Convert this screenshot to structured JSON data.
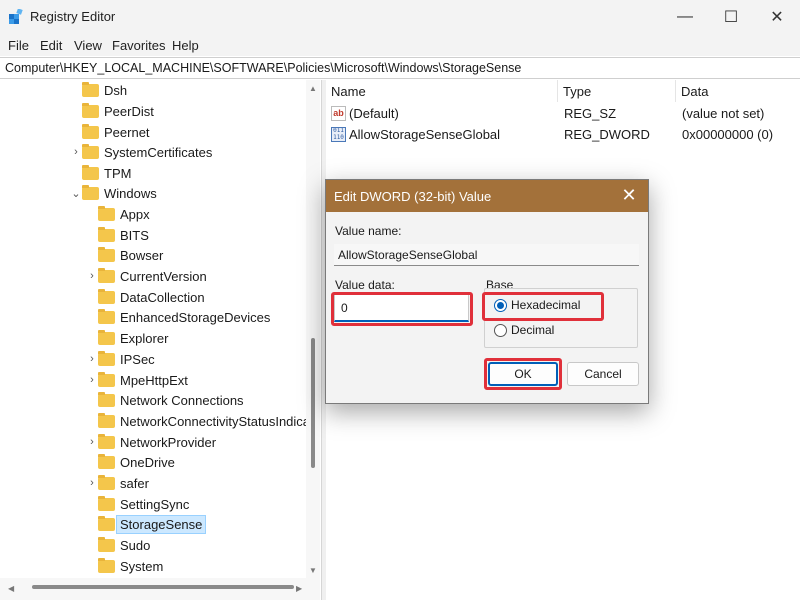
{
  "window": {
    "title": "Registry Editor",
    "minimize": "—",
    "maximize": "☐",
    "close": "✕"
  },
  "menu": [
    "File",
    "Edit",
    "View",
    "Favorites",
    "Help"
  ],
  "address": "Computer\\HKEY_LOCAL_MACHINE\\SOFTWARE\\Policies\\Microsoft\\Windows\\StorageSense",
  "tree": [
    {
      "label": "Dsh",
      "chevron": ""
    },
    {
      "label": "PeerDist",
      "chevron": ""
    },
    {
      "label": "Peernet",
      "chevron": ""
    },
    {
      "label": "SystemCertificates",
      "chevron": "›"
    },
    {
      "label": "TPM",
      "chevron": ""
    },
    {
      "label": "Windows",
      "chevron": "⌄"
    },
    {
      "label": "Appx",
      "chevron": ""
    },
    {
      "label": "BITS",
      "chevron": ""
    },
    {
      "label": "Bowser",
      "chevron": ""
    },
    {
      "label": "CurrentVersion",
      "chevron": "›"
    },
    {
      "label": "DataCollection",
      "chevron": ""
    },
    {
      "label": "EnhancedStorageDevices",
      "chevron": ""
    },
    {
      "label": "Explorer",
      "chevron": ""
    },
    {
      "label": "IPSec",
      "chevron": "›"
    },
    {
      "label": "MpeHttpExt",
      "chevron": "›"
    },
    {
      "label": "Network Connections",
      "chevron": ""
    },
    {
      "label": "NetworkConnectivityStatusIndicator",
      "chevron": ""
    },
    {
      "label": "NetworkProvider",
      "chevron": "›"
    },
    {
      "label": "OneDrive",
      "chevron": ""
    },
    {
      "label": "safer",
      "chevron": "›"
    },
    {
      "label": "SettingSync",
      "chevron": ""
    },
    {
      "label": "StorageSense",
      "chevron": ""
    },
    {
      "label": "Sudo",
      "chevron": ""
    },
    {
      "label": "System",
      "chevron": ""
    }
  ],
  "list": {
    "headers": {
      "name": "Name",
      "type": "Type",
      "data": "Data"
    },
    "rows": [
      {
        "name": "(Default)",
        "type": "REG_SZ",
        "data": "(value not set)",
        "icon": "ab",
        "icon_text": "ab"
      },
      {
        "name": "AllowStorageSenseGlobal",
        "type": "REG_DWORD",
        "data": "0x00000000 (0)",
        "icon": "binary",
        "icon_text": "011 110"
      }
    ]
  },
  "dialog": {
    "title": "Edit DWORD (32-bit) Value",
    "close": "✕",
    "value_name_label": "Value name:",
    "value_name": "AllowStorageSenseGlobal",
    "value_data_label": "Value data:",
    "value_data": "0",
    "base_label": "Base",
    "hex_label": "Hexadecimal",
    "dec_label": "Decimal",
    "selected_base": "Hexadecimal",
    "ok": "OK",
    "cancel": "Cancel"
  },
  "colors": {
    "dialog_title_bg": "#a3713a",
    "accent": "#005fb8",
    "highlight_box": "#e0303a",
    "folder": "#f4c64b"
  }
}
